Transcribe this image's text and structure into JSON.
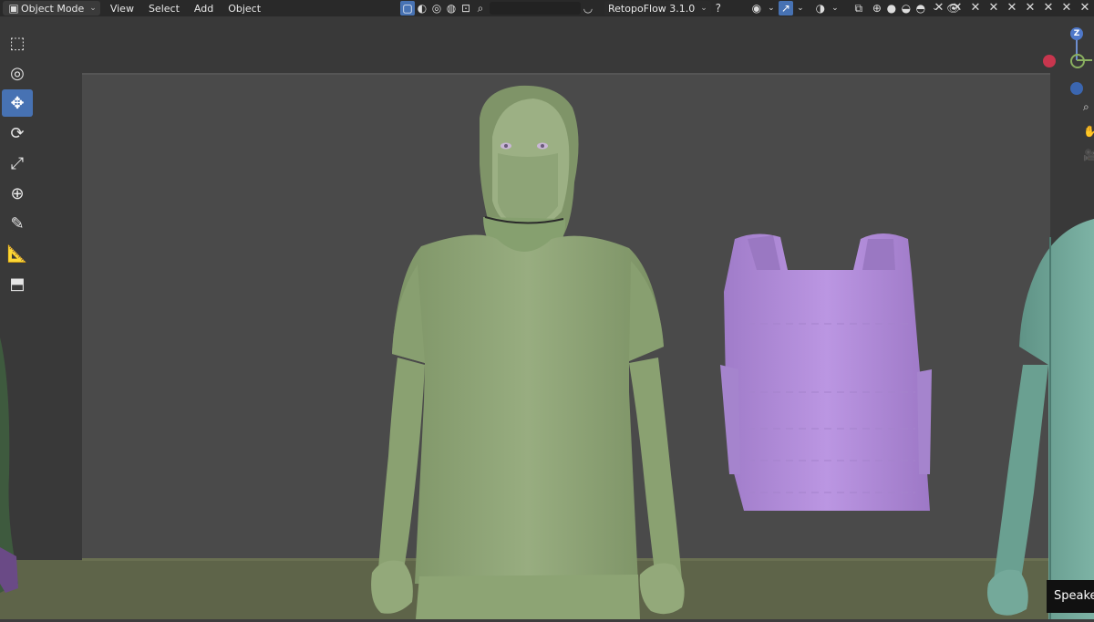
{
  "header": {
    "mode_label": "Object Mode",
    "menu": [
      "View",
      "Select",
      "Add",
      "Object"
    ],
    "search_placeholder": "",
    "addon_label": "RetopoFlow 3.1.0"
  },
  "toolbar": {
    "tools": [
      "select-box",
      "cursor",
      "move",
      "rotate",
      "scale",
      "transform",
      "annotate",
      "measure",
      "add-cube"
    ],
    "active_tool": "move"
  },
  "gizmo": {
    "axis_label": "Z"
  },
  "subtitle": {
    "text": "Speake"
  },
  "colors": {
    "header_bg": "#282828",
    "active_blue": "#4772b3",
    "body_green": "#8fa677",
    "vest_purple": "#b08cd8",
    "teal": "#6fa396"
  }
}
